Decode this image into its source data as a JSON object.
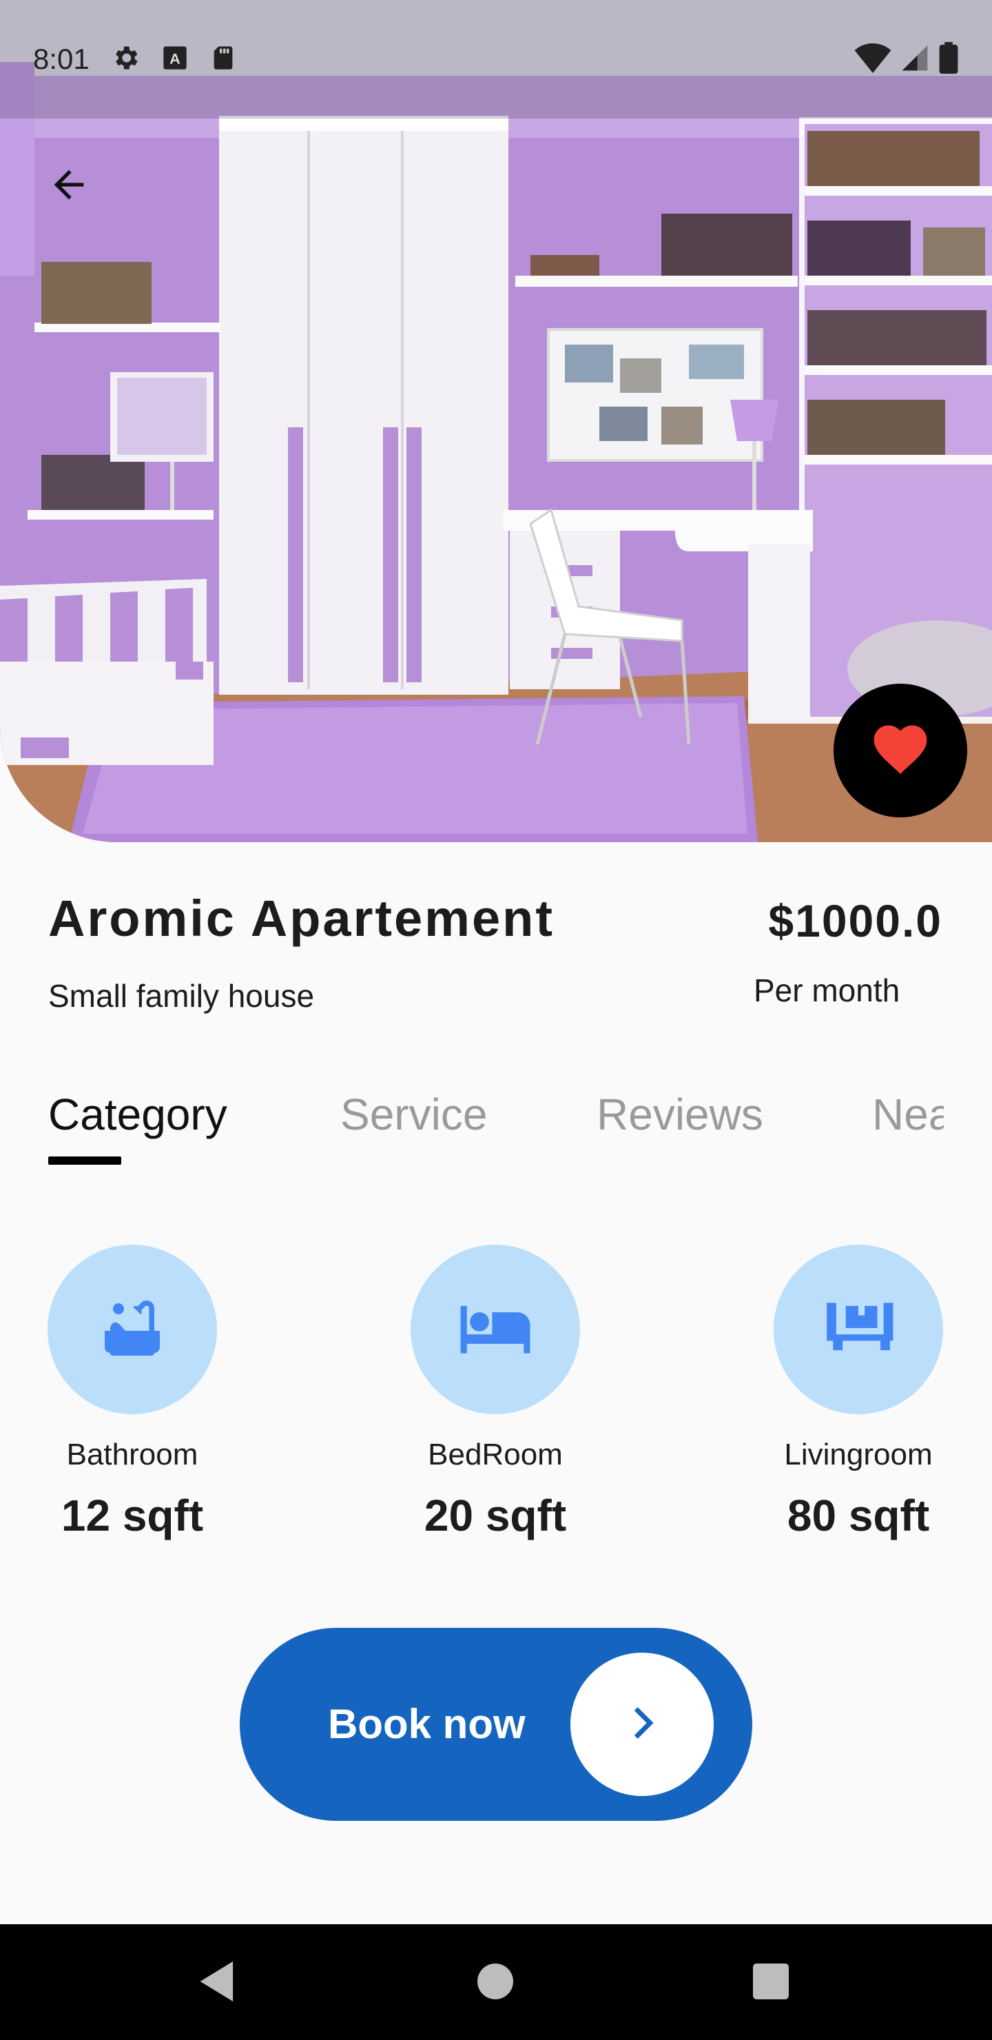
{
  "status_bar": {
    "time": "8:01",
    "left_icons": [
      "settings-icon",
      "text-a-icon",
      "sd-card-icon"
    ],
    "right_icons": [
      "wifi-icon",
      "signal-icon",
      "battery-icon"
    ]
  },
  "hero": {
    "image_description_icon": "bedroom-photo",
    "favorite_icon": "heart-icon",
    "favorite_color": "#f44336",
    "back_icon": "arrow-left-icon"
  },
  "listing": {
    "title": "Aromic Apartement",
    "subtitle": "Small family house",
    "price": "$1000.0",
    "price_period": "Per month"
  },
  "tabs": [
    {
      "label": "Category",
      "active": true
    },
    {
      "label": "Service",
      "active": false
    },
    {
      "label": "Reviews",
      "active": false
    },
    {
      "label": "Nea",
      "active": false
    }
  ],
  "categories": [
    {
      "name": "Bathroom",
      "size": "12 sqft",
      "icon": "bathtub-icon"
    },
    {
      "name": "BedRoom",
      "size": "20 sqft",
      "icon": "bed-icon"
    },
    {
      "name": "Livingroom",
      "size": "80 sqft",
      "icon": "sofa-icon"
    }
  ],
  "cta": {
    "label": "Book now",
    "icon": "chevron-right-icon",
    "color": "#1565c0"
  },
  "colors": {
    "accent": "#1565c0",
    "icon_bg": "#bbdefb",
    "icon_fg": "#4285f4"
  },
  "nav_bar": {
    "icons": [
      "back-triangle-icon",
      "home-circle-icon",
      "recents-square-icon"
    ]
  }
}
